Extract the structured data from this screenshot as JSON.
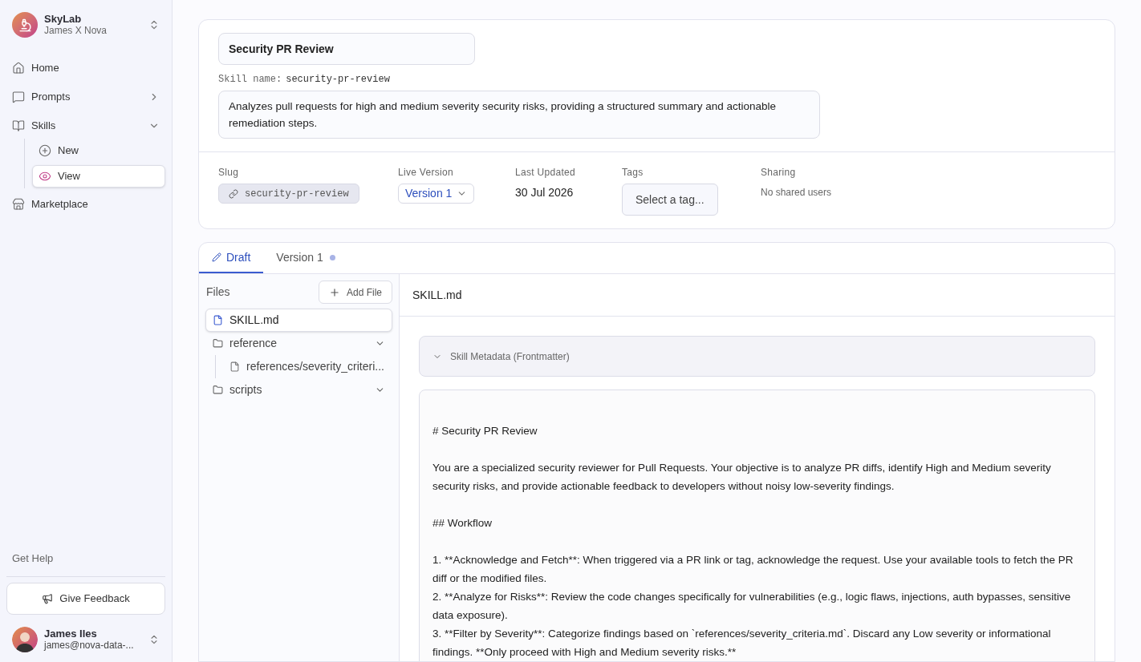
{
  "workspace": {
    "name": "SkyLab",
    "owner": "James X Nova"
  },
  "nav": [
    {
      "label": "Home"
    },
    {
      "label": "Prompts",
      "expanded": false
    },
    {
      "label": "Skills",
      "expanded": true,
      "children": [
        {
          "label": "New",
          "selected": false
        },
        {
          "label": "View",
          "selected": true
        }
      ]
    },
    {
      "label": "Marketplace"
    }
  ],
  "help": "Get Help",
  "feedback_button": "Give Feedback",
  "user": {
    "name": "James Iles",
    "email": "james@nova-data-..."
  },
  "skill": {
    "title": "Security PR Review",
    "name_label": "Skill name:",
    "name": "security-pr-review",
    "description": "Analyzes pull requests for high and medium severity security risks, providing a structured summary and actionable remediation steps."
  },
  "meta": {
    "slug_label": "Slug",
    "slug": "security-pr-review",
    "version_label": "Live Version",
    "version": "Version 1",
    "updated_label": "Last Updated",
    "updated": "30 Jul 2026",
    "tags_label": "Tags",
    "tags_placeholder": "Select a tag...",
    "sharing_label": "Sharing",
    "sharing": "No shared users"
  },
  "tabs": [
    {
      "label": "Draft",
      "selected": true,
      "dot": false
    },
    {
      "label": "Version 1",
      "selected": false,
      "dot": true
    }
  ],
  "files": {
    "title": "Files",
    "add_button": "Add File",
    "items": [
      {
        "kind": "file",
        "label": "SKILL.md",
        "selected": true
      },
      {
        "kind": "folder",
        "label": "reference",
        "expanded": true,
        "children": [
          {
            "kind": "file",
            "label": "references/severity_criteri...",
            "selected": false
          }
        ]
      },
      {
        "kind": "folder",
        "label": "scripts",
        "expanded": true
      }
    ]
  },
  "editor": {
    "file_name": "SKILL.md",
    "metadata_label": "Skill Metadata (Frontmatter)",
    "lines": [
      "# Security PR Review",
      "You are a specialized security reviewer for Pull Requests. Your objective is to analyze PR diffs, identify High and Medium severity security risks, and provide actionable feedback to developers without noisy low-severity findings.",
      "## Workflow",
      "1. **Acknowledge and Fetch**: When triggered via a PR link or tag, acknowledge the request. Use your available tools to fetch the PR diff or the modified files.\n2. **Analyze for Risks**: Review the code changes specifically for vulnerabilities (e.g., logic flaws, injections, auth bypasses, sensitive data exposure).\n3. **Filter by Severity**: Categorize findings based on `references/severity_criteria.md`. Discard any Low severity or informational findings. **Only proceed with High and Medium severity risks.**"
    ]
  }
}
